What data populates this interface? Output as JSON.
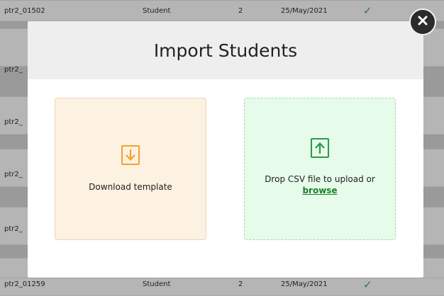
{
  "background_table": {
    "top_row": {
      "id": "ptr2_01502",
      "role": "Student",
      "count": "2",
      "date": "25/May/2021"
    },
    "partial_rows": [
      "ptr2_",
      "ptr2_",
      "ptr2_",
      "ptr2_",
      "ptr2_"
    ],
    "bottom_row": {
      "id": "ptr2_01259",
      "role": "Student",
      "count": "2",
      "date": "25/May/2021"
    },
    "check_glyph": "✓"
  },
  "modal": {
    "title": "Import Students",
    "download_card": {
      "icon": "download-arrow-icon",
      "label": "Download template",
      "accent": "#f1a42a",
      "background": "#fdf1e1"
    },
    "upload_card": {
      "icon": "upload-arrow-icon",
      "label": "Drop CSV file to upload or",
      "link_label": "browse",
      "accent": "#2e9a45",
      "background": "#e6fbea"
    }
  },
  "close_button": {
    "icon": "close-icon",
    "glyph": "✕"
  }
}
